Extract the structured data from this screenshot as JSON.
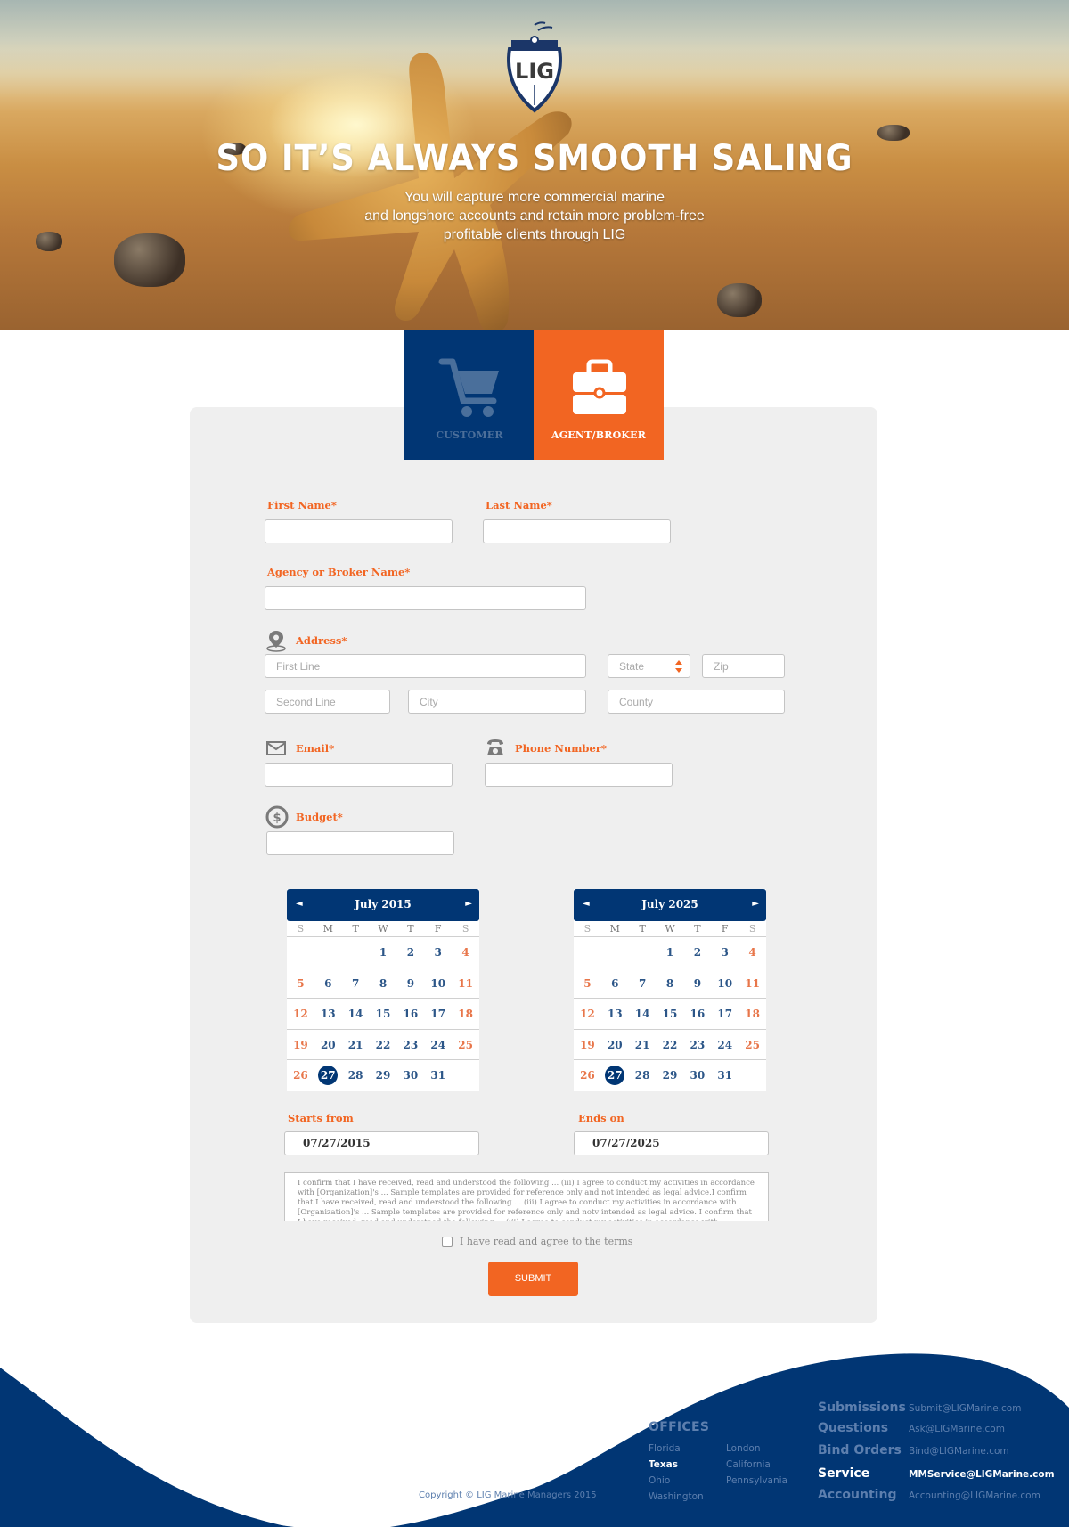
{
  "hero": {
    "logo_text": "LIG",
    "title": "SO IT’S ALWAYS SMOOTH SALING",
    "subtitle_lines": [
      "You will capture more commercial marine",
      "and longshore accounts and retain more problem-free",
      "profitable clients through LIG"
    ]
  },
  "tabs": [
    {
      "label": "CUSTOMER",
      "icon": "cart-icon",
      "active": false
    },
    {
      "label": "AGENT/BROKER",
      "icon": "briefcase-icon",
      "active": true
    }
  ],
  "form": {
    "first_name": {
      "label": "First Name*",
      "value": ""
    },
    "last_name": {
      "label": "Last Name*",
      "value": ""
    },
    "agency": {
      "label": "Agency or Broker Name*",
      "value": ""
    },
    "address": {
      "label": "Address*",
      "first_line_placeholder": "First Line",
      "second_line_placeholder": "Second Line",
      "city_placeholder": "City",
      "state_placeholder": "State",
      "zip_placeholder": "Zip",
      "county_placeholder": "County"
    },
    "email": {
      "label": "Email*",
      "value": ""
    },
    "phone": {
      "label": "Phone Number*",
      "value": ""
    },
    "budget": {
      "label": "Budget*",
      "value": ""
    },
    "calendars": [
      {
        "title": "July 2015",
        "weekday_headers": [
          "S",
          "M",
          "T",
          "W",
          "T",
          "F",
          "S"
        ],
        "weeks": [
          [
            "",
            "",
            "",
            "1",
            "2",
            "3",
            "4"
          ],
          [
            "5",
            "6",
            "7",
            "8",
            "9",
            "10",
            "11"
          ],
          [
            "12",
            "13",
            "14",
            "15",
            "16",
            "17",
            "18"
          ],
          [
            "19",
            "20",
            "21",
            "22",
            "23",
            "24",
            "25"
          ],
          [
            "26",
            "27",
            "28",
            "29",
            "30",
            "31",
            ""
          ]
        ],
        "selected_day": "27"
      },
      {
        "title": "July 2025",
        "weekday_headers": [
          "S",
          "M",
          "T",
          "W",
          "T",
          "F",
          "S"
        ],
        "weeks": [
          [
            "",
            "",
            "",
            "1",
            "2",
            "3",
            "4"
          ],
          [
            "5",
            "6",
            "7",
            "8",
            "9",
            "10",
            "11"
          ],
          [
            "12",
            "13",
            "14",
            "15",
            "16",
            "17",
            "18"
          ],
          [
            "19",
            "20",
            "21",
            "22",
            "23",
            "24",
            "25"
          ],
          [
            "26",
            "27",
            "28",
            "29",
            "30",
            "31",
            ""
          ]
        ],
        "selected_day": "27"
      }
    ],
    "nav_prev": "◄",
    "nav_next": "►",
    "starts_from": {
      "label": "Starts from",
      "value": "07/27/2015"
    },
    "ends_on": {
      "label": "Ends on",
      "value": "07/27/2025"
    },
    "terms_text": "I confirm that I have received, read and understood the following ... (iii) I agree to conduct my activities in accordance with [Organization]'s ... Sample templates are provided for reference only and not intended as legal advice.I confirm that I have received, read and understood the following ... (iii) I agree to conduct my activities in accordance with [Organization]'s ... Sample templates are provided for reference only and notv intended as legal advice. I confirm that I have received, read and understood the following ... (iii) I agree to conduct my activities in accordance with",
    "agree_label": "I have read and agree to the terms",
    "agree_checked": false,
    "submit_label": "SUBMIT"
  },
  "footer": {
    "copyright": "Copyright © LIG Marine Managers 2015",
    "offices_heading": "OFFICES",
    "offices_col1": [
      "Florida",
      "Texas",
      "Ohio",
      "Washington"
    ],
    "offices_col2": [
      "London",
      "California",
      "Pennsylvania"
    ],
    "active_office": "Texas",
    "contacts": [
      {
        "label": "Submissions",
        "email": "Submit@LIGMarine.com",
        "active": false
      },
      {
        "label": "Questions",
        "email": "Ask@LIGMarine.com",
        "active": false
      },
      {
        "label": "Bind Orders",
        "email": "Bind@LIGMarine.com",
        "active": false
      },
      {
        "label": "Service",
        "email": "MMService@LIGMarine.com",
        "active": true
      },
      {
        "label": "Accounting",
        "email": "Accounting@LIGMarine.com",
        "active": false
      }
    ]
  },
  "colors": {
    "brand_blue": "#013674",
    "brand_orange": "#f26522",
    "panel_bg": "#efefef"
  }
}
